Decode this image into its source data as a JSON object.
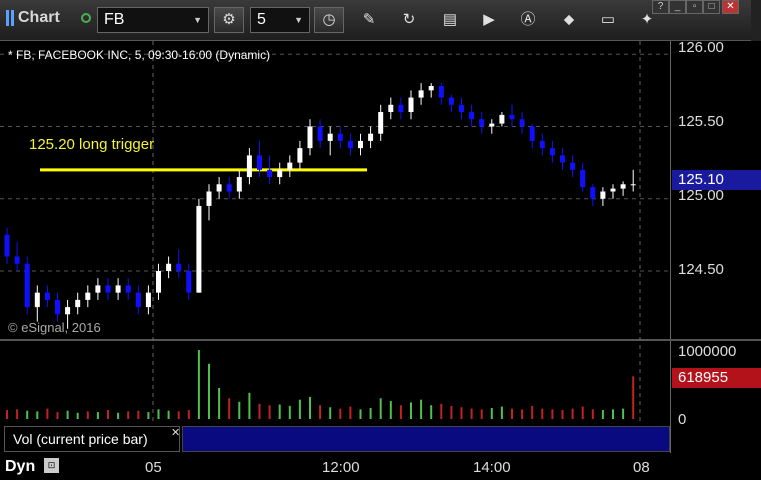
{
  "toolbar": {
    "title": "Chart",
    "symbol": "FB",
    "interval": "5"
  },
  "chart": {
    "info": "* FB, FACEBOOK INC, 5, 09:30-16:00 (Dynamic)",
    "copyright": "© eSignal, 2016",
    "annotation": "125.20 long trigger",
    "price_ticks": [
      "126.00",
      "125.50",
      "125.00",
      "124.50"
    ],
    "last_price": "125.10",
    "colors": {
      "up": "#ffffff",
      "down": "#1010ff",
      "trigger_line": "#ffff00",
      "vol_up": "#4ec24e",
      "vol_down": "#c22222"
    }
  },
  "volume": {
    "label": "Vol (current price bar)",
    "ticks": [
      "1000000",
      "0"
    ],
    "last_volume": "618955"
  },
  "bottom": {
    "mode": "Dyn",
    "time_labels": [
      "05",
      "12:00",
      "14:00",
      "08"
    ]
  },
  "chart_data": {
    "type": "candlestick",
    "title": "",
    "ylim": [
      124.05,
      126.05
    ],
    "trigger_level": 125.2,
    "candles": [
      [
        124.75,
        124.8,
        124.55,
        124.6
      ],
      [
        124.6,
        124.7,
        124.5,
        124.55
      ],
      [
        124.55,
        124.6,
        124.2,
        124.25
      ],
      [
        124.25,
        124.4,
        124.15,
        124.35
      ],
      [
        124.35,
        124.4,
        124.25,
        124.3
      ],
      [
        124.3,
        124.35,
        124.15,
        124.2
      ],
      [
        124.2,
        124.3,
        124.1,
        124.25
      ],
      [
        124.25,
        124.35,
        124.2,
        124.3
      ],
      [
        124.3,
        124.4,
        124.25,
        124.35
      ],
      [
        124.35,
        124.45,
        124.3,
        124.4
      ],
      [
        124.4,
        124.45,
        124.3,
        124.35
      ],
      [
        124.35,
        124.45,
        124.3,
        124.4
      ],
      [
        124.4,
        124.45,
        124.3,
        124.35
      ],
      [
        124.35,
        124.4,
        124.2,
        124.25
      ],
      [
        124.25,
        124.4,
        124.2,
        124.35
      ],
      [
        124.35,
        124.55,
        124.3,
        124.5
      ],
      [
        124.5,
        124.6,
        124.45,
        124.55
      ],
      [
        124.55,
        124.65,
        124.45,
        124.5
      ],
      [
        124.5,
        124.55,
        124.3,
        124.35
      ],
      [
        124.35,
        125.0,
        124.35,
        124.95
      ],
      [
        124.95,
        125.1,
        124.85,
        125.05
      ],
      [
        125.05,
        125.15,
        125.0,
        125.1
      ],
      [
        125.1,
        125.15,
        125.0,
        125.05
      ],
      [
        125.05,
        125.2,
        125.0,
        125.15
      ],
      [
        125.15,
        125.35,
        125.1,
        125.3
      ],
      [
        125.3,
        125.4,
        125.15,
        125.2
      ],
      [
        125.2,
        125.3,
        125.1,
        125.15
      ],
      [
        125.15,
        125.25,
        125.1,
        125.2
      ],
      [
        125.2,
        125.3,
        125.15,
        125.25
      ],
      [
        125.25,
        125.4,
        125.2,
        125.35
      ],
      [
        125.35,
        125.55,
        125.3,
        125.5
      ],
      [
        125.5,
        125.55,
        125.35,
        125.4
      ],
      [
        125.4,
        125.5,
        125.3,
        125.45
      ],
      [
        125.45,
        125.5,
        125.35,
        125.4
      ],
      [
        125.4,
        125.45,
        125.3,
        125.35
      ],
      [
        125.35,
        125.45,
        125.3,
        125.4
      ],
      [
        125.4,
        125.5,
        125.35,
        125.45
      ],
      [
        125.45,
        125.65,
        125.4,
        125.6
      ],
      [
        125.6,
        125.7,
        125.55,
        125.65
      ],
      [
        125.65,
        125.7,
        125.55,
        125.6
      ],
      [
        125.6,
        125.75,
        125.55,
        125.7
      ],
      [
        125.7,
        125.8,
        125.65,
        125.75
      ],
      [
        125.75,
        125.8,
        125.7,
        125.78
      ],
      [
        125.78,
        125.8,
        125.65,
        125.7
      ],
      [
        125.7,
        125.72,
        125.6,
        125.65
      ],
      [
        125.65,
        125.7,
        125.55,
        125.6
      ],
      [
        125.6,
        125.65,
        125.5,
        125.55
      ],
      [
        125.55,
        125.6,
        125.45,
        125.5
      ],
      [
        125.5,
        125.55,
        125.45,
        125.52
      ],
      [
        125.52,
        125.6,
        125.5,
        125.58
      ],
      [
        125.58,
        125.65,
        125.5,
        125.55
      ],
      [
        125.55,
        125.6,
        125.45,
        125.5
      ],
      [
        125.5,
        125.52,
        125.35,
        125.4
      ],
      [
        125.4,
        125.45,
        125.3,
        125.35
      ],
      [
        125.35,
        125.4,
        125.25,
        125.3
      ],
      [
        125.3,
        125.35,
        125.2,
        125.25
      ],
      [
        125.25,
        125.3,
        125.15,
        125.2
      ],
      [
        125.2,
        125.25,
        125.05,
        125.08
      ],
      [
        125.08,
        125.1,
        124.95,
        125.0
      ],
      [
        125.0,
        125.08,
        124.95,
        125.05
      ],
      [
        125.05,
        125.1,
        125.0,
        125.07
      ],
      [
        125.07,
        125.12,
        125.02,
        125.1
      ],
      [
        125.1,
        125.2,
        125.05,
        125.1
      ]
    ],
    "volumes": [
      [
        130000,
        0
      ],
      [
        140000,
        0
      ],
      [
        120000,
        1
      ],
      [
        110000,
        1
      ],
      [
        150000,
        0
      ],
      [
        100000,
        0
      ],
      [
        120000,
        1
      ],
      [
        90000,
        1
      ],
      [
        110000,
        0
      ],
      [
        100000,
        1
      ],
      [
        130000,
        0
      ],
      [
        90000,
        1
      ],
      [
        110000,
        0
      ],
      [
        120000,
        0
      ],
      [
        100000,
        1
      ],
      [
        140000,
        1
      ],
      [
        120000,
        1
      ],
      [
        110000,
        0
      ],
      [
        130000,
        0
      ],
      [
        1000000,
        1
      ],
      [
        800000,
        1
      ],
      [
        450000,
        1
      ],
      [
        300000,
        0
      ],
      [
        250000,
        1
      ],
      [
        380000,
        1
      ],
      [
        220000,
        0
      ],
      [
        200000,
        0
      ],
      [
        210000,
        1
      ],
      [
        190000,
        1
      ],
      [
        280000,
        1
      ],
      [
        320000,
        1
      ],
      [
        200000,
        0
      ],
      [
        170000,
        1
      ],
      [
        150000,
        0
      ],
      [
        180000,
        0
      ],
      [
        140000,
        1
      ],
      [
        160000,
        1
      ],
      [
        300000,
        1
      ],
      [
        260000,
        1
      ],
      [
        200000,
        0
      ],
      [
        240000,
        1
      ],
      [
        280000,
        1
      ],
      [
        200000,
        1
      ],
      [
        220000,
        0
      ],
      [
        190000,
        0
      ],
      [
        170000,
        0
      ],
      [
        150000,
        0
      ],
      [
        140000,
        0
      ],
      [
        160000,
        1
      ],
      [
        180000,
        1
      ],
      [
        150000,
        0
      ],
      [
        140000,
        0
      ],
      [
        190000,
        0
      ],
      [
        150000,
        0
      ],
      [
        140000,
        0
      ],
      [
        130000,
        0
      ],
      [
        150000,
        0
      ],
      [
        180000,
        0
      ],
      [
        140000,
        0
      ],
      [
        130000,
        1
      ],
      [
        140000,
        1
      ],
      [
        150000,
        1
      ],
      [
        618955,
        0
      ]
    ]
  }
}
